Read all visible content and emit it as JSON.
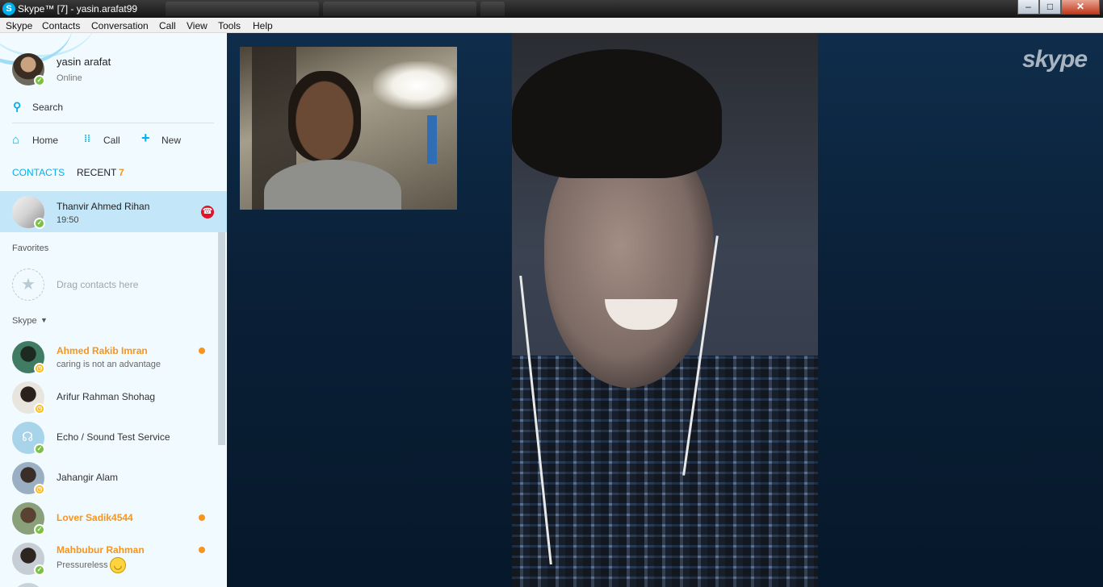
{
  "window": {
    "title": "Skype™ [7] - yasin.arafat99",
    "app_icon": "S",
    "buttons": {
      "minimize": "–",
      "maximize": "□",
      "close": "✕"
    }
  },
  "menu": [
    "Skype",
    "Contacts",
    "Conversation",
    "Call",
    "View",
    "Tools",
    "Help"
  ],
  "profile": {
    "name": "yasin arafat",
    "status": "Online"
  },
  "search": {
    "label": "Search"
  },
  "nav": {
    "home": "Home",
    "call": "Call",
    "new": "New"
  },
  "tabs": {
    "contacts": "CONTACTS",
    "recent": "RECENT",
    "recent_count": "7"
  },
  "active_call": {
    "name": "Thanvir Ahmed Rihan",
    "time": "19:50"
  },
  "favorites": {
    "heading": "Favorites",
    "placeholder": "Drag contacts here"
  },
  "group": {
    "heading": "Skype"
  },
  "contacts": [
    {
      "name": "Ahmed Rakib Imran",
      "mood": "caring is not an advantage",
      "status": "away",
      "highlight": true
    },
    {
      "name": "Arifur Rahman Shohag",
      "mood": "",
      "status": "away",
      "highlight": false
    },
    {
      "name": "Echo / Sound Test Service",
      "mood": "",
      "status": "online",
      "highlight": false
    },
    {
      "name": "Jahangir Alam",
      "mood": "",
      "status": "away",
      "highlight": false
    },
    {
      "name": "Lover Sadik4544",
      "mood": "",
      "status": "online",
      "highlight": true
    },
    {
      "name": "Mahbubur Rahman",
      "mood": "Pressureless",
      "status": "online",
      "highlight": true
    }
  ],
  "branding": {
    "logo": "skype"
  },
  "colors": {
    "accent": "#00aff0",
    "highlight": "#f7941d",
    "online": "#7ac143",
    "away": "#fdb813",
    "end_call": "#e0132a"
  }
}
